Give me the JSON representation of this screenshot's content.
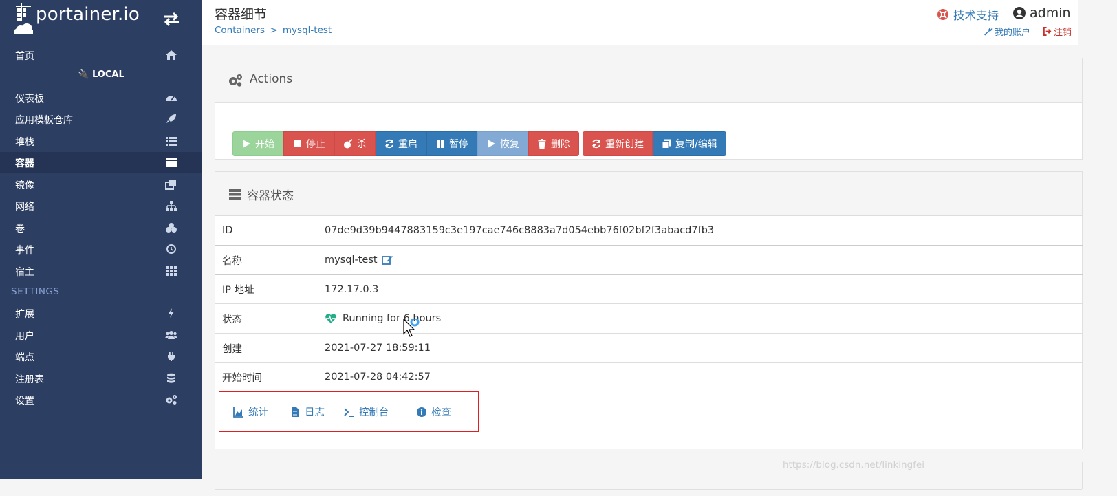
{
  "sidebar": {
    "brand": "portainer.io",
    "items_top": [
      {
        "label": "首页",
        "icon": "home-icon"
      }
    ],
    "endpoint": "LOCAL",
    "items": [
      {
        "label": "仪表板",
        "icon": "dashboard-icon"
      },
      {
        "label": "应用模板仓库",
        "icon": "rocket-icon"
      },
      {
        "label": "堆栈",
        "icon": "list-icon"
      },
      {
        "label": "容器",
        "icon": "server-icon",
        "active": true
      },
      {
        "label": "镜像",
        "icon": "clone-icon"
      },
      {
        "label": "网络",
        "icon": "sitemap-icon"
      },
      {
        "label": "卷",
        "icon": "cubes-icon"
      },
      {
        "label": "事件",
        "icon": "history-icon"
      },
      {
        "label": "宿主",
        "icon": "th-icon"
      }
    ],
    "settings_label": "SETTINGS",
    "settings_items": [
      {
        "label": "扩展",
        "icon": "bolt-icon"
      },
      {
        "label": "用户",
        "icon": "users-icon"
      },
      {
        "label": "端点",
        "icon": "plug-icon"
      },
      {
        "label": "注册表",
        "icon": "database-icon"
      },
      {
        "label": "设置",
        "icon": "cogs-icon"
      }
    ]
  },
  "header": {
    "title": "容器细节",
    "breadcrumb_root": "Containers",
    "breadcrumb_sep": ">",
    "breadcrumb_current": "mysql-test",
    "support": "技术支持",
    "user": "admin",
    "my_account": "我的账户",
    "logout": "注销"
  },
  "actions": {
    "title": "Actions",
    "buttons": [
      {
        "label": "开始",
        "icon": "play-icon"
      },
      {
        "label": "停止",
        "icon": "stop-icon"
      },
      {
        "label": "杀",
        "icon": "bomb-icon"
      },
      {
        "label": "重启",
        "icon": "refresh-icon"
      },
      {
        "label": "暂停",
        "icon": "pause-icon"
      },
      {
        "label": "恢复",
        "icon": "play-icon"
      },
      {
        "label": "删除",
        "icon": "trash-icon"
      },
      {
        "label": "重新创建",
        "icon": "refresh-icon"
      },
      {
        "label": "复制/编辑",
        "icon": "copy-icon"
      }
    ]
  },
  "status": {
    "title": "容器状态",
    "rows": [
      {
        "key": "ID",
        "value": "07de9d39b9447883159c3e197cae746c8883a7d054ebb76f02bf2f3abacd7fb3"
      },
      {
        "key": "名称",
        "value": "mysql-test"
      },
      {
        "key": "IP 地址",
        "value": "172.17.0.3"
      },
      {
        "key": "状态",
        "value": "Running for 6 hours"
      },
      {
        "key": "创建",
        "value": "2021-07-27 18:59:11"
      },
      {
        "key": "开始时间",
        "value": "2021-07-28 04:42:57"
      }
    ],
    "tabs": [
      {
        "label": "统计",
        "icon": "area-chart-icon"
      },
      {
        "label": "日志",
        "icon": "file-text-icon"
      },
      {
        "label": "控制台",
        "icon": "terminal-icon"
      },
      {
        "label": "检查",
        "icon": "info-circle-icon"
      }
    ]
  },
  "watermark": "https://blog.csdn.net/linkingfei",
  "colors": {
    "sidebar_bg": "#2d3e63",
    "link": "#337ab7",
    "danger": "#d9534f",
    "success": "#5cb85c",
    "healthy": "#23ae89"
  }
}
